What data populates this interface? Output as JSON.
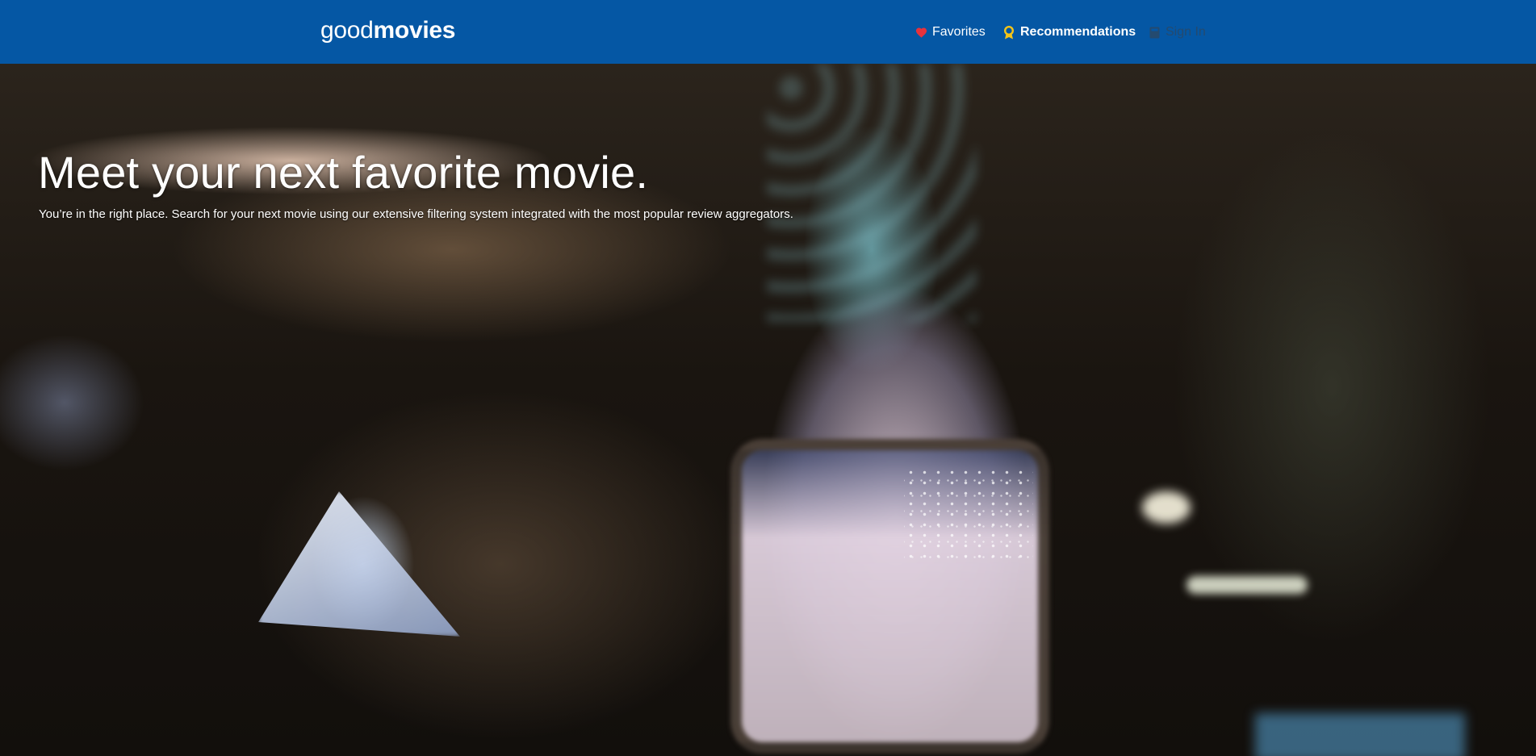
{
  "navbar": {
    "brand_light": "good",
    "brand_bold": "movies",
    "items": [
      {
        "label": "Favorites",
        "icon": "heart-icon",
        "color": "#e8323c"
      },
      {
        "label": "Recommendations",
        "icon": "award-ribbon-icon",
        "color": "#f5c518"
      },
      {
        "label": "Sign In",
        "icon": "book-icon",
        "color": "#244a6f"
      }
    ],
    "background": "#0557a4"
  },
  "hero": {
    "title": "Meet your next favorite movie.",
    "subtitle": "You’re in the right place. Search for your next movie using our extensive filtering system integrated with the most popular review aggregators."
  }
}
